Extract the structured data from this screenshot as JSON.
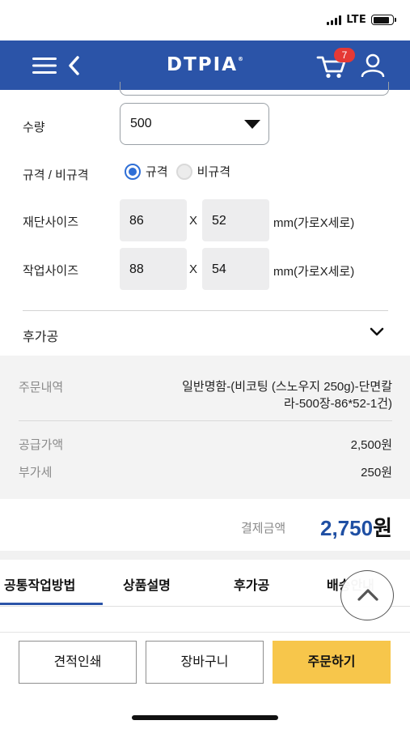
{
  "status_bar": {
    "network": "LTE",
    "battery_level": 0.85
  },
  "header": {
    "logo": "DTPIA",
    "logo_mark": "®",
    "cart_count": "7"
  },
  "form": {
    "quantity": {
      "label": "수량",
      "value": "500"
    },
    "spec": {
      "label": "규격 / 비규격",
      "options": [
        "규격",
        "비규격"
      ],
      "selected": "규격"
    },
    "cut_size": {
      "label": "재단사이즈",
      "width": "86",
      "height": "52",
      "unit": "mm(가로X세로)"
    },
    "work_size": {
      "label": "작업사이즈",
      "width": "88",
      "height": "54",
      "unit": "mm(가로X세로)"
    },
    "separator": "X",
    "post_processing": {
      "label": "후가공"
    }
  },
  "summary": {
    "order_detail_label": "주문내역",
    "order_detail_line1": "일반명함-(비코팅 (스노우지 250g)-단면칼",
    "order_detail_line2": "라-500장-86*52-1건)",
    "supply_price_label": "공급가액",
    "supply_price": "2,500원",
    "vat_label": "부가세",
    "vat": "250원",
    "total_label": "결제금액",
    "total_amount": "2,750",
    "total_currency": "원"
  },
  "tabs": [
    {
      "label": "공통작업방법",
      "active": true
    },
    {
      "label": "상품설명",
      "active": false
    },
    {
      "label": "후가공",
      "active": false
    },
    {
      "label": "배송안내",
      "active": false
    }
  ],
  "actions": {
    "quote_print": "견적인쇄",
    "cart": "장바구니",
    "order": "주문하기"
  },
  "colors": {
    "brand_blue": "#2b54a8",
    "order_yellow": "#f7c64b",
    "badge_red": "#e53935",
    "total_blue": "#1f4fa3"
  }
}
